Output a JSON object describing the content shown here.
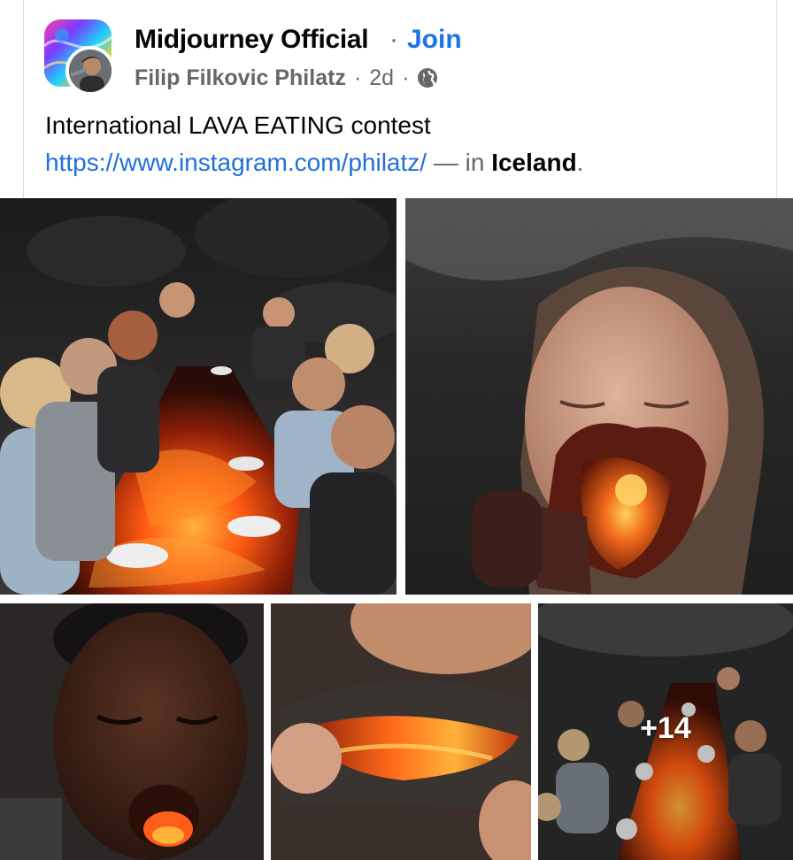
{
  "post": {
    "group_name": "Midjourney Official",
    "separator": "·",
    "join_label": "Join",
    "author": "Filip Filkovic Philatz",
    "time": "2d",
    "audience_icon": "globe-icon",
    "text": "International LAVA EATING contest",
    "link": "https://www.instagram.com/philatz/",
    "location_prefix": " — in ",
    "location": "Iceland",
    "location_suffix": "."
  },
  "gallery": {
    "photos": [
      {
        "subject": "group-eating-at-lava-table"
      },
      {
        "subject": "woman-eating-lava"
      },
      {
        "subject": "man-eating-lava"
      },
      {
        "subject": "lava-bite-closeup"
      },
      {
        "subject": "lava-table-crowd"
      }
    ],
    "more_count": "+14"
  },
  "colors": {
    "link_blue": "#216fdb",
    "join_blue": "#1b74e4",
    "secondary_text": "#65676b",
    "lava_orange": "#ff6a1a"
  }
}
